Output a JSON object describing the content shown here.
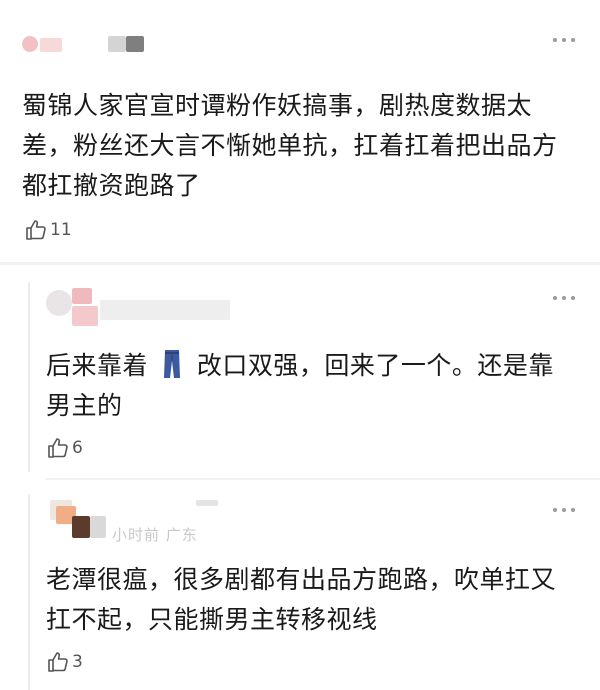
{
  "comments": [
    {
      "text": "蜀锦人家官宣时谭粉作妖搞事，剧热度数据太差，粉丝还大言不惭她单抗，扛着扛着把出品方都扛撤资跑路了",
      "likes": "11"
    },
    {
      "text_before": "后来靠着",
      "text_after": "改口双强，回来了一个。还是靠男主的",
      "likes": "6"
    },
    {
      "text": "老潭很瘟，很多剧都有出品方跑路，吹单扛又扛不起，只能撕男主转移视线",
      "meta": "小时前 广东",
      "likes": "3"
    }
  ],
  "icons": {
    "like": "thumbs-up-icon",
    "more": "more-dots-icon",
    "jeans": "jeans-icon"
  },
  "colors": {
    "text": "#1a1a1a",
    "muted": "#555555",
    "divider": "#f2f2f2",
    "jeans": "#3d5a9e"
  }
}
